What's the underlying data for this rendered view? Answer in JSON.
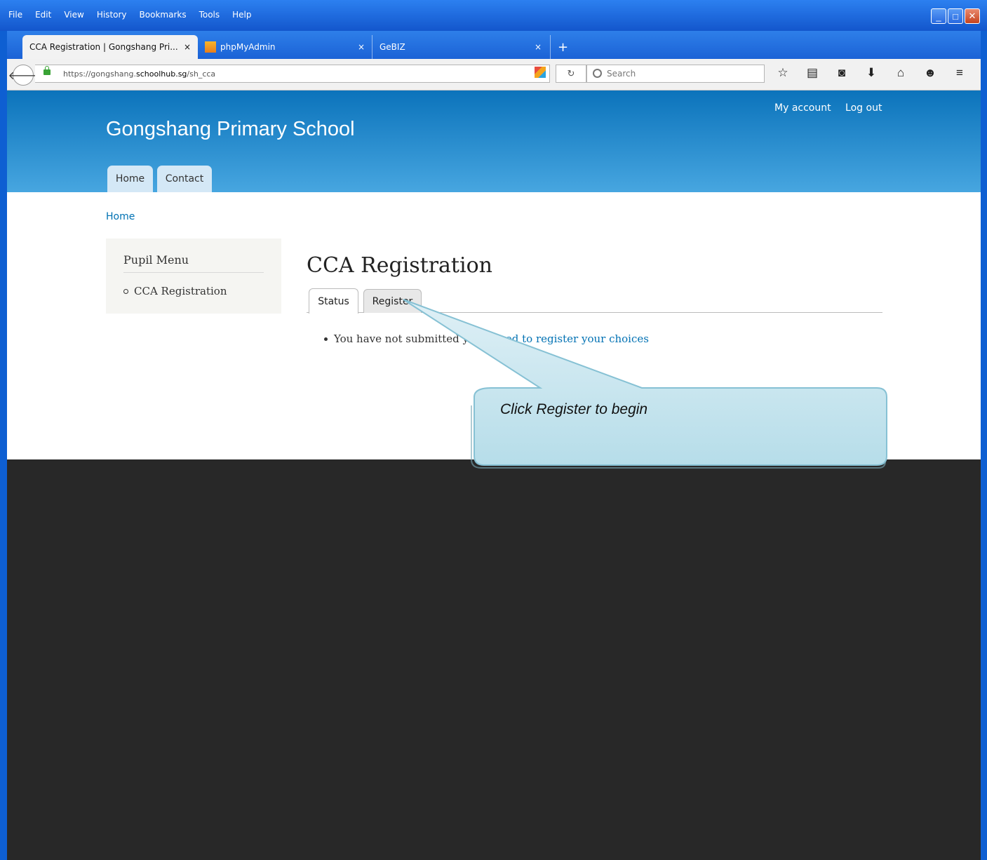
{
  "menubar": [
    "File",
    "Edit",
    "View",
    "History",
    "Bookmarks",
    "Tools",
    "Help"
  ],
  "tabs": [
    {
      "label": "CCA Registration | Gongshang Pri...",
      "close": "×"
    },
    {
      "label": "phpMyAdmin",
      "close": "×"
    },
    {
      "label": "GeBIZ",
      "close": "×"
    }
  ],
  "new_tab": "+",
  "url": {
    "prefix": "https://gongshang.",
    "domain": "schoolhub.sg",
    "path": "/sh_cca"
  },
  "search_placeholder": "Search",
  "site": {
    "name": "Gongshang Primary School",
    "my_account": "My account",
    "log_out": "Log out",
    "nav": [
      "Home",
      "Contact"
    ],
    "breadcrumb": "Home"
  },
  "sidebar": {
    "title": "Pupil Menu",
    "items": [
      "CCA Registration"
    ]
  },
  "content": {
    "title": "CCA Registration",
    "tabs": [
      "Status",
      "Register"
    ],
    "message_prefix": "You have not submitted y",
    "message_link": "eed to register your choices"
  },
  "callout": "Click Register to begin"
}
